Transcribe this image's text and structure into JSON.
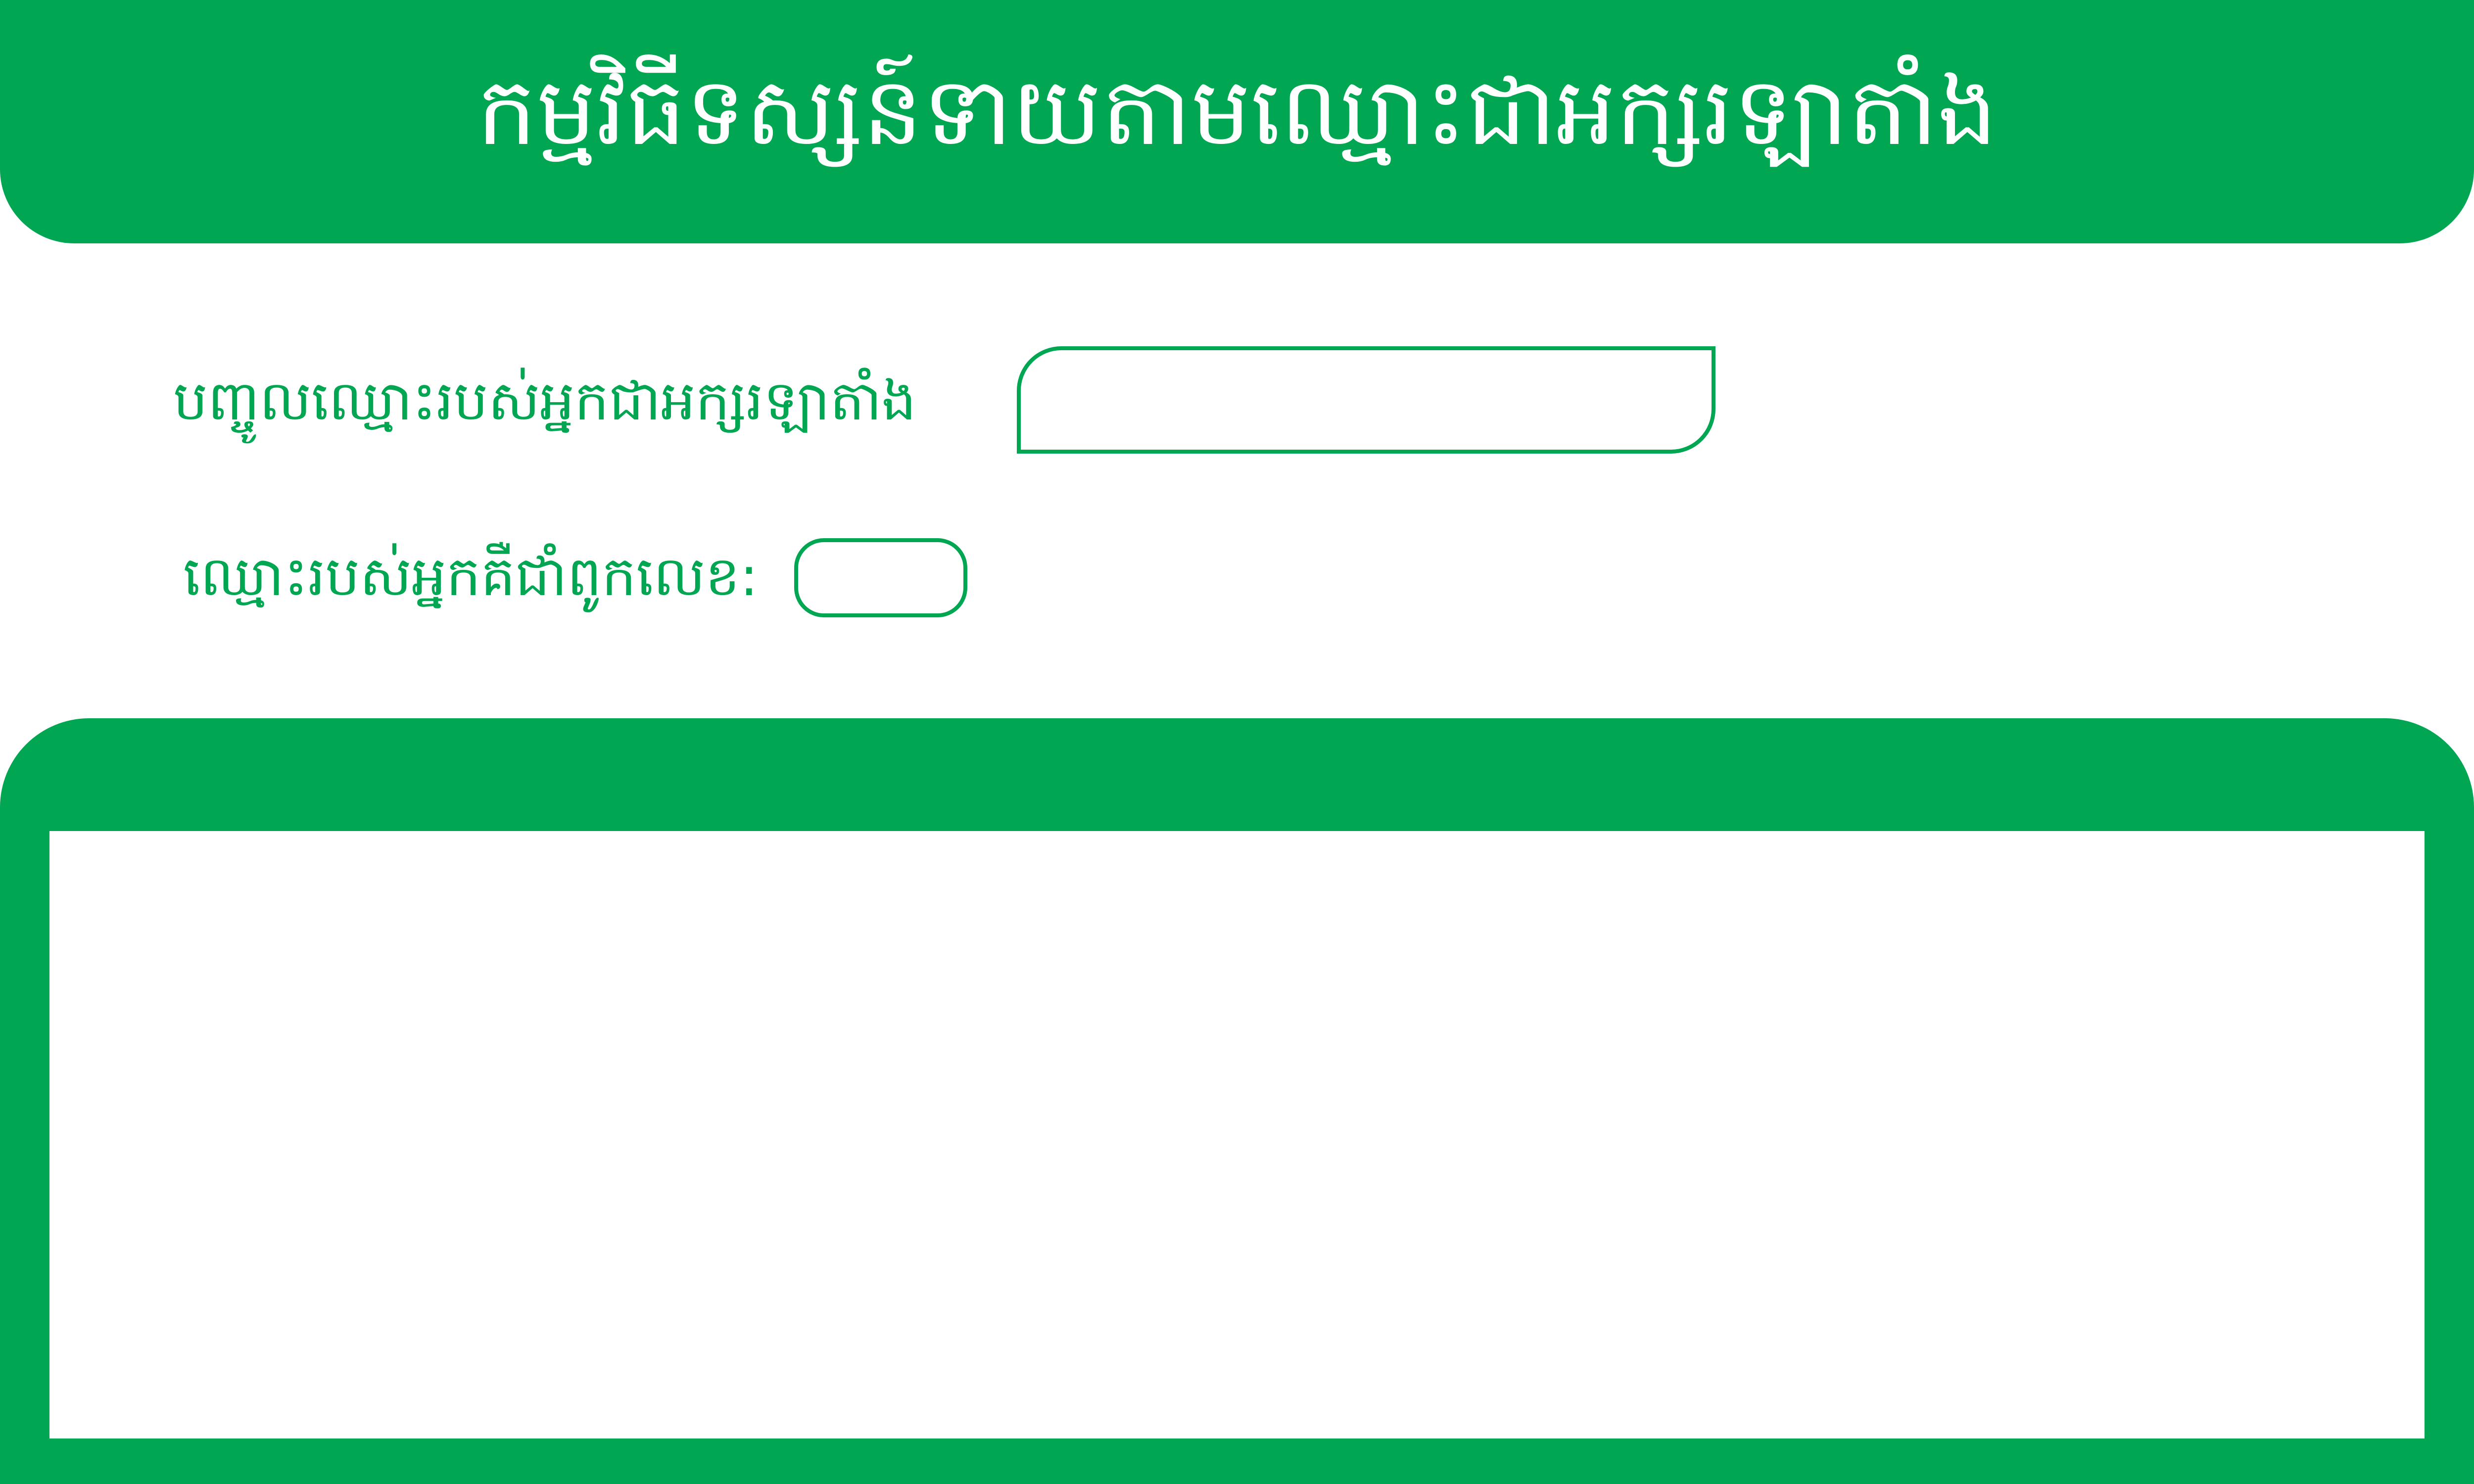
{
  "header": {
    "title": "កម្មវិធីទស្សន៍ទាយតាមឈ្មោះជាអក្សរឡាតាំង"
  },
  "form": {
    "name_label": "បញ្ចូលឈ្មោះរបស់អ្នកជាអក្សរឡាតាំង",
    "name_input_value": "",
    "name_input_placeholder": "",
    "count_label": "ឈ្មោះរបស់អ្នកគឺជាំពូកលេខ:",
    "count_value": ""
  },
  "output": {
    "text": ""
  },
  "colors": {
    "accent": "#00a651",
    "background": "#ffffff",
    "title_text": "#ffffff"
  }
}
